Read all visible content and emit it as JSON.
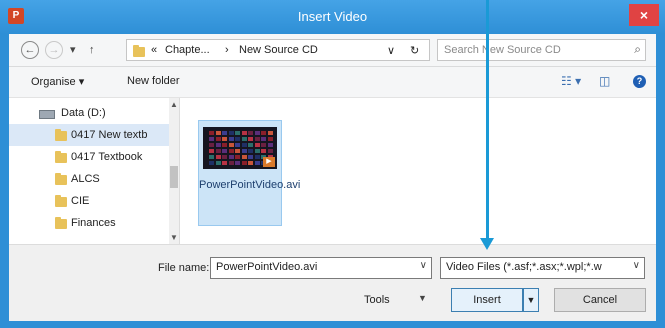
{
  "window": {
    "title": "Insert Video",
    "app_icon": "P",
    "close_glyph": "×"
  },
  "address_bar": {
    "back_glyph": "←",
    "forward_glyph": "→",
    "recent_glyph": "▾",
    "up_glyph": "↑",
    "overflow_glyph": "«",
    "crumb_1": "Chapte...",
    "separator": "›",
    "crumb_2": "New Source CD",
    "dropdown_glyph": "∨",
    "refresh_glyph": "↻"
  },
  "search": {
    "placeholder": "Search New Source CD",
    "icon_glyph": "⌕"
  },
  "toolbar": {
    "organise_label": "Organise ▾",
    "new_folder_label": "New folder",
    "view_glyph": "☷ ▾",
    "preview_glyph": "◫",
    "help_glyph": "?"
  },
  "nav_pane": {
    "items": [
      {
        "label": "Data (D:)"
      },
      {
        "label": "0417 New textb"
      },
      {
        "label": "0417 Textbook"
      },
      {
        "label": "ALCS"
      },
      {
        "label": "CIE"
      },
      {
        "label": "Finances"
      }
    ],
    "scroll_up": "▲",
    "scroll_down": "▼"
  },
  "files": [
    {
      "name": "PowerPointVideo.avi",
      "play_glyph": "▶"
    }
  ],
  "bottom": {
    "file_name_label": "File name:",
    "file_name_value": "PowerPointVideo.avi",
    "file_type_value": "Video Files (*.asf;*.asx;*.wpl;*.w",
    "combo_arrow": "∨",
    "tools_label": "Tools",
    "tools_arrow": "▼",
    "insert_label": "Insert",
    "insert_split_glyph": "▼",
    "cancel_label": "Cancel"
  },
  "colors": {
    "titlebar": "#2e8fd6",
    "callout": "#1a9ad6",
    "close": "#e04343",
    "selection": "#cce4f7"
  }
}
